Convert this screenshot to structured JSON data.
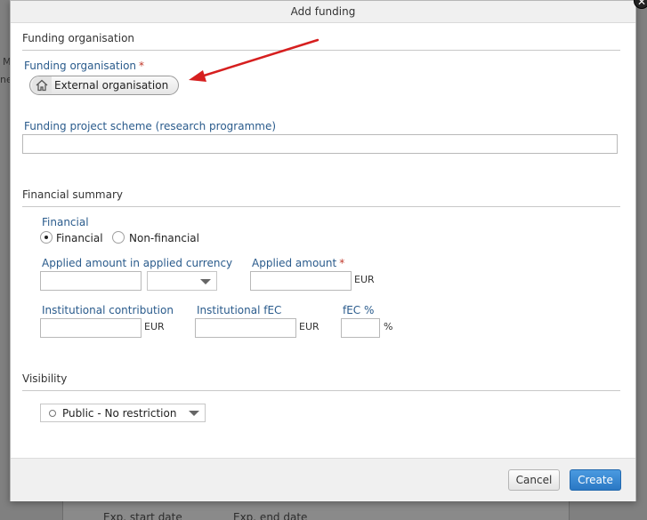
{
  "dialog": {
    "title": "Add funding"
  },
  "background": {
    "left_fragment_1": "M",
    "left_fragment_2": "ne",
    "lower_label_1": "Exp. start date",
    "lower_label_2": "Exp. end date"
  },
  "sections": {
    "funding_organisation": {
      "header": "Funding organisation",
      "org_label": "Funding organisation",
      "org_chip_label": "External organisation",
      "org_chip_icon": "home-icon",
      "scheme_label": "Funding project scheme (research programme)",
      "scheme_value": ""
    },
    "financial_summary": {
      "header": "Financial summary",
      "financial_label": "Financial",
      "radio_financial": "Financial",
      "radio_non_financial": "Non-financial",
      "selected_radio": "Financial",
      "applied_currency_label": "Applied amount in applied currency",
      "applied_currency_value": "",
      "currency_select_value": "",
      "applied_amount_label": "Applied amount",
      "applied_amount_value": "",
      "applied_amount_unit": "EUR",
      "institutional_contribution_label": "Institutional contribution",
      "institutional_contribution_value": "",
      "institutional_contribution_unit": "EUR",
      "institutional_fec_label": "Institutional fEC",
      "institutional_fec_value": "",
      "institutional_fec_unit": "EUR",
      "fec_percent_label": "fEC %",
      "fec_percent_value": "",
      "fec_percent_unit": "%"
    },
    "visibility": {
      "header": "Visibility",
      "selected_value": "Public - No restriction"
    }
  },
  "footer": {
    "cancel_label": "Cancel",
    "create_label": "Create"
  },
  "colors": {
    "label_blue": "#2a5b8c",
    "required_star": "#c0392b",
    "primary_button": "#2a78c4",
    "annotation_arrow": "#d61f1f"
  },
  "required_marker": "*"
}
